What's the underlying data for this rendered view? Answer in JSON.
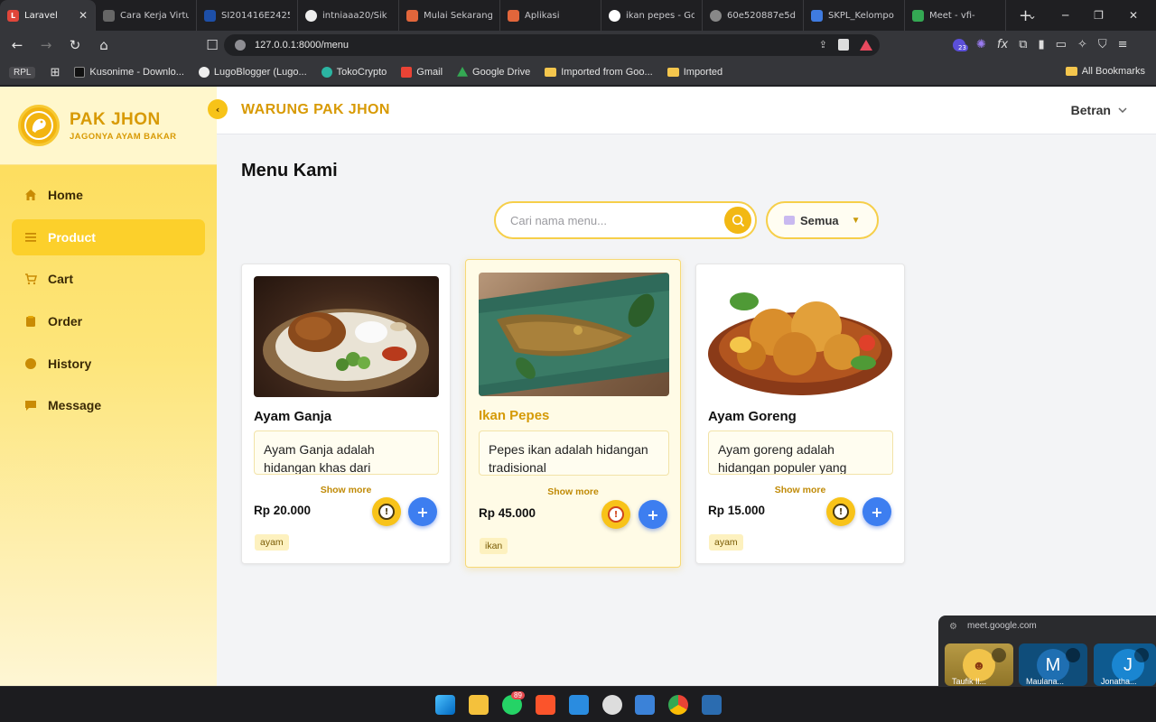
{
  "browser": {
    "tabs": [
      {
        "title": "Laravel",
        "active": true
      },
      {
        "title": "Cara Kerja Virtu"
      },
      {
        "title": "SI201416E2425"
      },
      {
        "title": "intniaaa20/Sik"
      },
      {
        "title": "Mulai Sekarang"
      },
      {
        "title": "Aplikasi"
      },
      {
        "title": "ikan pepes - Go"
      },
      {
        "title": "60e520887e5d"
      },
      {
        "title": "SKPL_Kelompo"
      },
      {
        "title": "Meet - vfi-"
      }
    ],
    "url": "127.0.0.1:8000/menu",
    "extension_badge": "23",
    "bookmarks": [
      "RPL",
      "Kusonime - Downlo...",
      "LugoBlogger (Lugo...",
      "TokoCrypto",
      "Gmail",
      "Google Drive",
      "Imported from Goo...",
      "Imported"
    ],
    "all_bookmarks": "All Bookmarks"
  },
  "sidebar": {
    "brand_name": "PAK JHON",
    "brand_tagline": "JAGONYA AYAM BAKAR",
    "items": [
      {
        "label": "Home",
        "icon": "home-icon"
      },
      {
        "label": "Product",
        "icon": "list-icon",
        "active": true
      },
      {
        "label": "Cart",
        "icon": "cart-icon"
      },
      {
        "label": "Order",
        "icon": "order-icon"
      },
      {
        "label": "History",
        "icon": "history-icon"
      },
      {
        "label": "Message",
        "icon": "message-icon"
      }
    ]
  },
  "header": {
    "title": "WARUNG PAK JHON",
    "user": "Betran"
  },
  "main": {
    "page_title": "Menu Kami",
    "search_placeholder": "Cari nama menu...",
    "filter_value": "Semua",
    "products": [
      {
        "name": "Ayam Ganja",
        "description": "Ayam Ganja adalah hidangan khas dari",
        "show_more": "Show more",
        "price": "Rp 20.000",
        "tag": "ayam"
      },
      {
        "name": "Ikan Pepes",
        "description": "Pepes ikan adalah hidangan tradisional",
        "show_more": "Show more",
        "price": "Rp 45.000",
        "tag": "ikan",
        "highlighted": true
      },
      {
        "name": "Ayam Goreng",
        "description": "Ayam goreng adalah hidangan populer yang",
        "show_more": "Show more",
        "price": "Rp 15.000",
        "tag": "ayam"
      }
    ]
  },
  "meet_popup": {
    "url": "meet.google.com",
    "participants": [
      {
        "name": "Taufik Il..."
      },
      {
        "name": "Maulana...",
        "initial": "M"
      },
      {
        "name": "Jonatha...",
        "initial": "J"
      }
    ]
  },
  "taskbar": {
    "whatsapp_badge": "89"
  },
  "colors": {
    "accent": "#f2b814",
    "brand_text": "#d89a05",
    "add_button": "#3d7ef0"
  }
}
